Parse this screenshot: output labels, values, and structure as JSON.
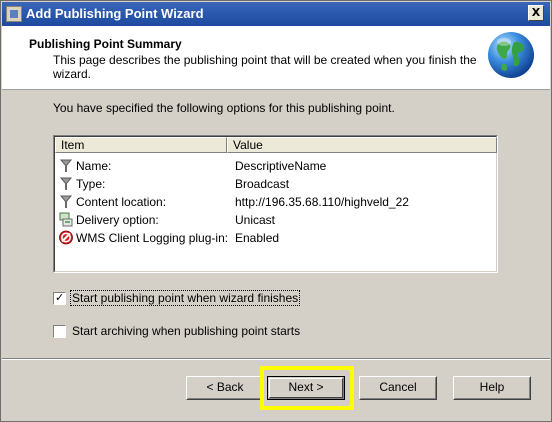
{
  "window": {
    "title": "Add Publishing Point Wizard",
    "close_label": "X"
  },
  "header": {
    "title": "Publishing Point Summary",
    "description": "This page describes the publishing point that will be created when you finish the wizard."
  },
  "intro": "You have specified the following options for this publishing point.",
  "listview": {
    "columns": [
      "Item",
      "Value"
    ],
    "rows": [
      {
        "name": "Name:",
        "value": "DescriptiveName",
        "icon": "property-icon"
      },
      {
        "name": "Type:",
        "value": "Broadcast",
        "icon": "property-icon"
      },
      {
        "name": "Content location:",
        "value": "http://196.35.68.110/highveld_22",
        "icon": "property-icon"
      },
      {
        "name": "Delivery option:",
        "value": "Unicast",
        "icon": "delivery-icon"
      },
      {
        "name": "WMS Client Logging plug-in:",
        "value": "Enabled",
        "icon": "plugin-icon"
      }
    ]
  },
  "options": {
    "start_publishing": {
      "label": "Start publishing point when wizard finishes",
      "checked": true
    },
    "start_archiving": {
      "label": "Start archiving when publishing point starts",
      "checked": false
    }
  },
  "buttons": {
    "back": "< Back",
    "next": "Next >",
    "cancel": "Cancel",
    "help": "Help"
  },
  "colors": {
    "titlebar": "#2a58ad",
    "highlight": "#ffff00"
  }
}
